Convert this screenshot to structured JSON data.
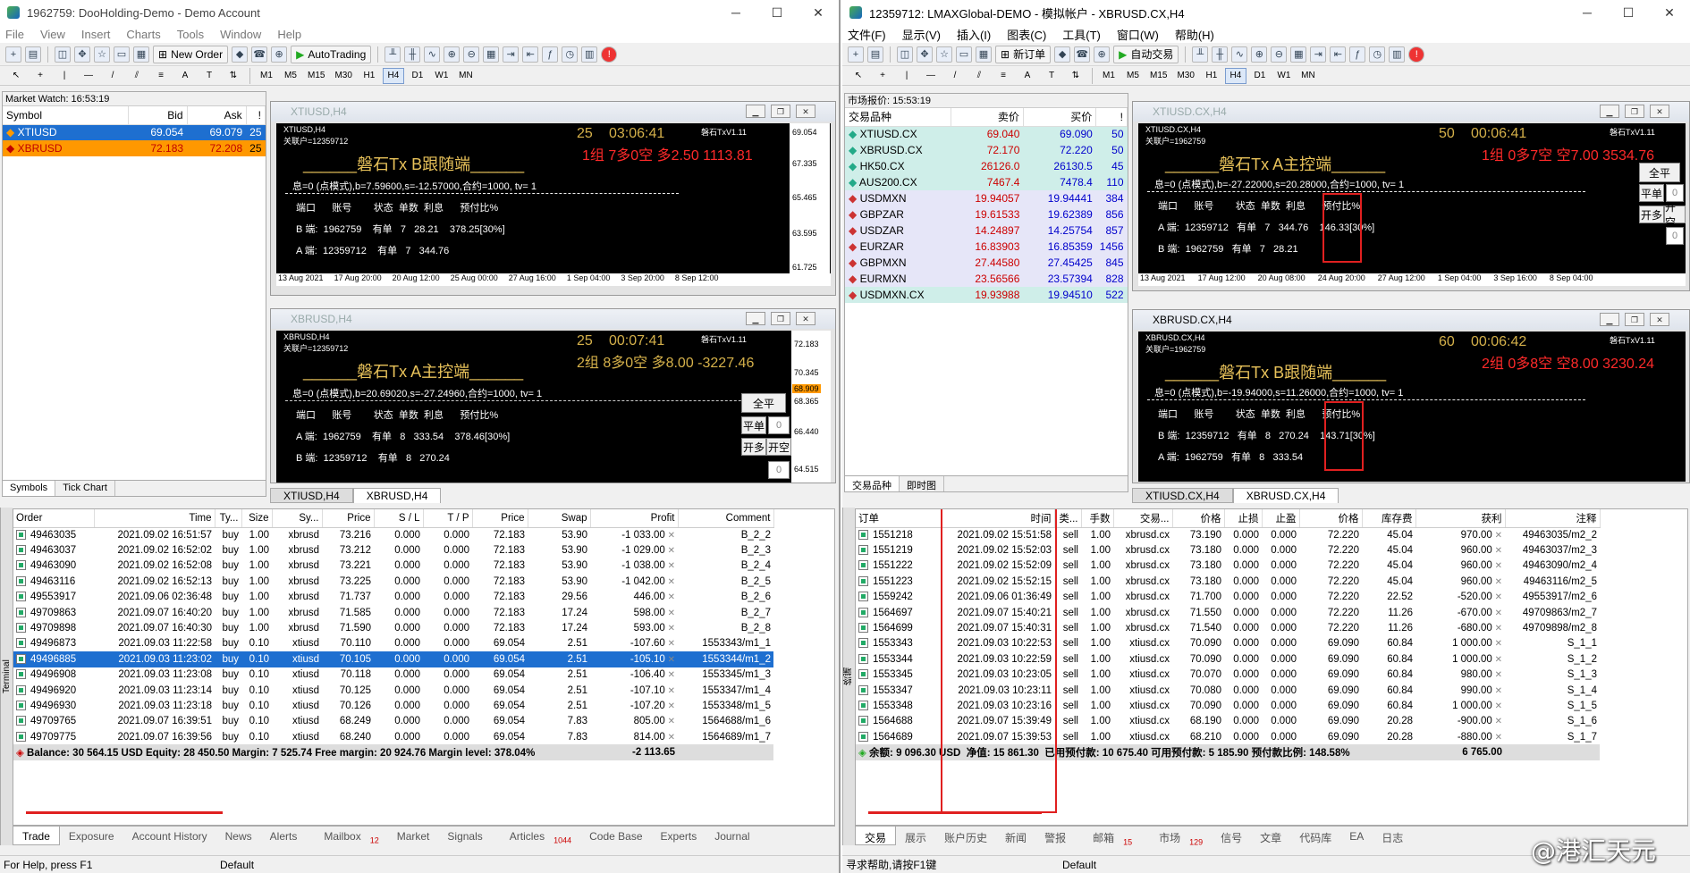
{
  "left": {
    "title": "1962759: DooHolding-Demo - Demo Account",
    "menu": [
      "File",
      "View",
      "Insert",
      "Charts",
      "Tools",
      "Window",
      "Help"
    ],
    "new_order": "New Order",
    "autotrading": "AutoTrading",
    "timeframes": [
      "M1",
      "M5",
      "M15",
      "M30",
      "H1",
      "H4",
      "D1",
      "W1",
      "MN"
    ],
    "market_watch": {
      "title": "Market Watch: 16:53:19",
      "headers": [
        "Symbol",
        "Bid",
        "Ask",
        "!"
      ],
      "rows": [
        [
          "XTIUSD",
          "69.054",
          "69.079",
          "25"
        ],
        [
          "XBRUSD",
          "72.183",
          "72.208",
          "25"
        ]
      ],
      "tabs": [
        "Symbols",
        "Tick Chart"
      ]
    },
    "chart1": {
      "title": "XTIUSD,H4",
      "sym": "XTIUSD,H4",
      "acct": "关联户=12359712",
      "ea": "磐石TxV1.11",
      "count": "25",
      "timer": "03:06:41",
      "status": "1组 7多0空 多2.50 1113.81",
      "heading": "磐石Tx B跟随端",
      "params": "息=0 (点模式),b=7.59600,s=-12.57000,合约=1000, tv= 1",
      "headers": [
        "端口",
        "账号",
        "状态",
        "单数",
        "利息",
        "预付比%"
      ],
      "b_row": [
        "B 端:",
        "1962759",
        "有单",
        "7",
        "28.21",
        "378.25[30%]"
      ],
      "a_row": [
        "A 端:",
        "12359712",
        "有单",
        "7",
        "344.76"
      ],
      "yaxis": [
        "69.054",
        "67.335",
        "65.465",
        "63.595",
        "61.725"
      ],
      "xaxis": [
        "13 Aug 2021",
        "17 Aug 20:00",
        "20 Aug 12:00",
        "25 Aug 00:00",
        "27 Aug 16:00",
        "1 Sep 04:00",
        "3 Sep 20:00",
        "8 Sep 12:00"
      ]
    },
    "chart2": {
      "title": "XBRUSD,H4",
      "sym": "XBRUSD,H4",
      "acct": "关联户=12359712",
      "ea": "磐石TxV1.11",
      "count": "25",
      "timer": "00:07:41",
      "status": "2组 8多0空 多8.00 -3227.46",
      "heading": "磐石Tx A主控端",
      "params": "息=0 (点模式),b=20.69020,s=-27.24960,合约=1000, tv= 1",
      "headers": [
        "端口",
        "账号",
        "状态",
        "单数",
        "利息",
        "预付比%"
      ],
      "a_row": [
        "A 端:",
        "1962759",
        "有单",
        "8",
        "333.54",
        "378.46[30%]"
      ],
      "b_row": [
        "B 端:",
        "12359712",
        "有单",
        "8",
        "270.24"
      ],
      "yaxis": [
        "72.183",
        "70.345",
        "68.909",
        "68.365",
        "66.440",
        "64.515"
      ],
      "btn_close_all": "全平",
      "btn_close": "平单",
      "btn_open_long": "开多",
      "btn_open_short": "开空",
      "val0": "0"
    },
    "chart_tabs": [
      "XTIUSD,H4",
      "XBRUSD,H4"
    ],
    "terminal": {
      "headers": [
        "Order",
        "Time",
        "Ty...",
        "Size",
        "Sy...",
        "Price",
        "S / L",
        "T / P",
        "Price",
        "Swap",
        "Profit",
        "Comment"
      ],
      "rows": [
        [
          "49463035",
          "2021.09.02 16:51:57",
          "buy",
          "1.00",
          "xbrusd",
          "73.216",
          "0.000",
          "0.000",
          "72.183",
          "53.90",
          "-1 033.00",
          "B_2_2"
        ],
        [
          "49463037",
          "2021.09.02 16:52:02",
          "buy",
          "1.00",
          "xbrusd",
          "73.212",
          "0.000",
          "0.000",
          "72.183",
          "53.90",
          "-1 029.00",
          "B_2_3"
        ],
        [
          "49463090",
          "2021.09.02 16:52:08",
          "buy",
          "1.00",
          "xbrusd",
          "73.221",
          "0.000",
          "0.000",
          "72.183",
          "53.90",
          "-1 038.00",
          "B_2_4"
        ],
        [
          "49463116",
          "2021.09.02 16:52:13",
          "buy",
          "1.00",
          "xbrusd",
          "73.225",
          "0.000",
          "0.000",
          "72.183",
          "53.90",
          "-1 042.00",
          "B_2_5"
        ],
        [
          "49553917",
          "2021.09.06 02:36:48",
          "buy",
          "1.00",
          "xbrusd",
          "71.737",
          "0.000",
          "0.000",
          "72.183",
          "29.56",
          "446.00",
          "B_2_6"
        ],
        [
          "49709863",
          "2021.09.07 16:40:20",
          "buy",
          "1.00",
          "xbrusd",
          "71.585",
          "0.000",
          "0.000",
          "72.183",
          "17.24",
          "598.00",
          "B_2_7"
        ],
        [
          "49709898",
          "2021.09.07 16:40:30",
          "buy",
          "1.00",
          "xbrusd",
          "71.590",
          "0.000",
          "0.000",
          "72.183",
          "17.24",
          "593.00",
          "B_2_8"
        ],
        [
          "49496873",
          "2021.09.03 11:22:58",
          "buy",
          "0.10",
          "xtiusd",
          "70.110",
          "0.000",
          "0.000",
          "69.054",
          "2.51",
          "-107.60",
          "1553343/m1_1"
        ],
        [
          "49496885",
          "2021.09.03 11:23:02",
          "buy",
          "0.10",
          "xtiusd",
          "70.105",
          "0.000",
          "0.000",
          "69.054",
          "2.51",
          "-105.10",
          "1553344/m1_2"
        ],
        [
          "49496908",
          "2021.09.03 11:23:08",
          "buy",
          "0.10",
          "xtiusd",
          "70.118",
          "0.000",
          "0.000",
          "69.054",
          "2.51",
          "-106.40",
          "1553345/m1_3"
        ],
        [
          "49496920",
          "2021.09.03 11:23:14",
          "buy",
          "0.10",
          "xtiusd",
          "70.125",
          "0.000",
          "0.000",
          "69.054",
          "2.51",
          "-107.10",
          "1553347/m1_4"
        ],
        [
          "49496930",
          "2021.09.03 11:23:18",
          "buy",
          "0.10",
          "xtiusd",
          "70.126",
          "0.000",
          "0.000",
          "69.054",
          "2.51",
          "-107.20",
          "1553348/m1_5"
        ],
        [
          "49709765",
          "2021.09.07 16:39:51",
          "buy",
          "0.10",
          "xtiusd",
          "68.249",
          "0.000",
          "0.000",
          "69.054",
          "7.83",
          "805.00",
          "1564688/m1_6"
        ],
        [
          "49709775",
          "2021.09.07 16:39:56",
          "buy",
          "0.10",
          "xtiusd",
          "68.240",
          "0.000",
          "0.000",
          "69.054",
          "7.83",
          "814.00",
          "1564689/m1_7"
        ]
      ],
      "selected": 8,
      "summary": "Balance: 30 564.15 USD  Equity: 28 450.50  Margin: 7 525.74  Free margin: 20 924.76  Margin level: 378.04%",
      "summary_profit": "-2 113.65",
      "tabs": [
        "Trade",
        "Exposure",
        "Account History",
        "News",
        "Alerts",
        "Mailbox",
        "Market",
        "Signals",
        "Articles",
        "Code Base",
        "Experts",
        "Journal"
      ],
      "mailbox_badge": "12",
      "articles_badge": "1044",
      "side": "Terminal"
    },
    "status": {
      "help": "For Help, press F1",
      "profile": "Default"
    }
  },
  "right": {
    "title": "12359712: LMAXGlobal-DEMO - 模拟帐户 - XBRUSD.CX,H4",
    "menu": [
      "文件(F)",
      "显示(V)",
      "插入(I)",
      "图表(C)",
      "工具(T)",
      "窗口(W)",
      "帮助(H)"
    ],
    "new_order": "新订单",
    "autotrading": "自动交易",
    "timeframes": [
      "M1",
      "M5",
      "M15",
      "M30",
      "H1",
      "H4",
      "D1",
      "W1",
      "MN"
    ],
    "market_watch": {
      "title": "市场报价: 15:53:19",
      "headers": [
        "交易品种",
        "卖价",
        "买价",
        "!"
      ],
      "rows": [
        [
          "XTIUSD.CX",
          "69.040",
          "69.090",
          "50"
        ],
        [
          "XBRUSD.CX",
          "72.170",
          "72.220",
          "50"
        ],
        [
          "HK50.CX",
          "26126.0",
          "26130.5",
          "45"
        ],
        [
          "AUS200.CX",
          "7467.4",
          "7478.4",
          "110"
        ],
        [
          "USDMXN",
          "19.94057",
          "19.94441",
          "384"
        ],
        [
          "GBPZAR",
          "19.61533",
          "19.62389",
          "856"
        ],
        [
          "USDZAR",
          "14.24897",
          "14.25754",
          "857"
        ],
        [
          "EURZAR",
          "16.83903",
          "16.85359",
          "1456"
        ],
        [
          "GBPMXN",
          "27.44580",
          "27.45425",
          "845"
        ],
        [
          "EURMXN",
          "23.56566",
          "23.57394",
          "828"
        ],
        [
          "USDMXN.CX",
          "19.93988",
          "19.94510",
          "522"
        ]
      ],
      "tabs": [
        "交易品种",
        "即时图"
      ]
    },
    "chart1": {
      "title": "XTIUSD.CX,H4",
      "sym": "XTIUSD.CX,H4",
      "acct": "关联户=1962759",
      "ea": "磐石TxV1.11",
      "count": "50",
      "timer": "00:06:41",
      "status": "1组 0多7空 空7.00 3534.76",
      "heading": "磐石Tx A主控端",
      "params": "息=0 (点模式),b=-27.22000,s=20.28000,合约=1000, tv= 1",
      "headers": [
        "端口",
        "账号",
        "状态",
        "单数",
        "利息",
        "预付比%"
      ],
      "a_row": [
        "A 端:",
        "12359712",
        "有单",
        "7",
        "344.76",
        "146.33[30%]"
      ],
      "b_row": [
        "B 端:",
        "1962759",
        "有单",
        "7",
        "28.21"
      ],
      "xaxis": [
        "13 Aug 2021",
        "17 Aug 12:00",
        "20 Aug 08:00",
        "24 Aug 20:00",
        "27 Aug 12:00",
        "1 Sep 04:00",
        "3 Sep 16:00",
        "8 Sep 04:00"
      ],
      "btn_close_all": "全平",
      "btn_close": "平单",
      "btn_open_long": "开多",
      "btn_open_short": "开空",
      "val0": "0"
    },
    "chart2": {
      "title": "XBRUSD.CX,H4",
      "sym": "XBRUSD.CX,H4",
      "acct": "关联户=1962759",
      "ea": "磐石TxV1.11",
      "count": "60",
      "timer": "00:06:42",
      "status": "2组 0多8空 空8.00 3230.24",
      "heading": "磐石Tx B跟随端",
      "params": "息=0 (点模式),b=-19.94000,s=11.26000,合约=1000, tv= 1",
      "headers": [
        "端口",
        "账号",
        "状态",
        "单数",
        "利息",
        "预付比%"
      ],
      "b_row": [
        "B 端:",
        "12359712",
        "有单",
        "8",
        "270.24",
        "143.71[30%]"
      ],
      "a_row": [
        "A 端:",
        "1962759",
        "有单",
        "8",
        "333.54"
      ]
    },
    "chart_tabs": [
      "XTIUSD.CX,H4",
      "XBRUSD.CX,H4"
    ],
    "terminal": {
      "headers": [
        "订单",
        "时间",
        "类...",
        "手数",
        "交易...",
        "价格",
        "止损",
        "止盈",
        "价格",
        "库存费",
        "获利",
        "注释"
      ],
      "rows": [
        [
          "1551218",
          "2021.09.02 15:51:58",
          "sell",
          "1.00",
          "xbrusd.cx",
          "73.190",
          "0.000",
          "0.000",
          "72.220",
          "45.04",
          "970.00",
          "49463035/m2_2"
        ],
        [
          "1551219",
          "2021.09.02 15:52:03",
          "sell",
          "1.00",
          "xbrusd.cx",
          "73.180",
          "0.000",
          "0.000",
          "72.220",
          "45.04",
          "960.00",
          "49463037/m2_3"
        ],
        [
          "1551222",
          "2021.09.02 15:52:09",
          "sell",
          "1.00",
          "xbrusd.cx",
          "73.180",
          "0.000",
          "0.000",
          "72.220",
          "45.04",
          "960.00",
          "49463090/m2_4"
        ],
        [
          "1551223",
          "2021.09.02 15:52:15",
          "sell",
          "1.00",
          "xbrusd.cx",
          "73.180",
          "0.000",
          "0.000",
          "72.220",
          "45.04",
          "960.00",
          "49463116/m2_5"
        ],
        [
          "1559242",
          "2021.09.06 01:36:49",
          "sell",
          "1.00",
          "xbrusd.cx",
          "71.700",
          "0.000",
          "0.000",
          "72.220",
          "22.52",
          "-520.00",
          "49553917/m2_6"
        ],
        [
          "1564697",
          "2021.09.07 15:40:21",
          "sell",
          "1.00",
          "xbrusd.cx",
          "71.550",
          "0.000",
          "0.000",
          "72.220",
          "11.26",
          "-670.00",
          "49709863/m2_7"
        ],
        [
          "1564699",
          "2021.09.07 15:40:31",
          "sell",
          "1.00",
          "xbrusd.cx",
          "71.540",
          "0.000",
          "0.000",
          "72.220",
          "11.26",
          "-680.00",
          "49709898/m2_8"
        ],
        [
          "1553343",
          "2021.09.03 10:22:53",
          "sell",
          "1.00",
          "xtiusd.cx",
          "70.090",
          "0.000",
          "0.000",
          "69.090",
          "60.84",
          "1 000.00",
          "S_1_1"
        ],
        [
          "1553344",
          "2021.09.03 10:22:59",
          "sell",
          "1.00",
          "xtiusd.cx",
          "70.090",
          "0.000",
          "0.000",
          "69.090",
          "60.84",
          "1 000.00",
          "S_1_2"
        ],
        [
          "1553345",
          "2021.09.03 10:23:05",
          "sell",
          "1.00",
          "xtiusd.cx",
          "70.070",
          "0.000",
          "0.000",
          "69.090",
          "60.84",
          "980.00",
          "S_1_3"
        ],
        [
          "1553347",
          "2021.09.03 10:23:11",
          "sell",
          "1.00",
          "xtiusd.cx",
          "70.080",
          "0.000",
          "0.000",
          "69.090",
          "60.84",
          "990.00",
          "S_1_4"
        ],
        [
          "1553348",
          "2021.09.03 10:23:16",
          "sell",
          "1.00",
          "xtiusd.cx",
          "70.090",
          "0.000",
          "0.000",
          "69.090",
          "60.84",
          "1 000.00",
          "S_1_5"
        ],
        [
          "1564688",
          "2021.09.07 15:39:49",
          "sell",
          "1.00",
          "xtiusd.cx",
          "68.190",
          "0.000",
          "0.000",
          "69.090",
          "20.28",
          "-900.00",
          "S_1_6"
        ],
        [
          "1564689",
          "2021.09.07 15:39:53",
          "sell",
          "1.00",
          "xtiusd.cx",
          "68.210",
          "0.000",
          "0.000",
          "69.090",
          "20.28",
          "-880.00",
          "S_1_7"
        ]
      ],
      "summary_balance": "余额: 9 096.30 USD",
      "summary_equity": "净值: 15 861.30",
      "summary_rest": "已用预付款: 10 675.40  可用预付款: 5 185.90  预付款比例: 148.58%",
      "summary_profit": "6 765.00",
      "tabs": [
        "交易",
        "展示",
        "账户历史",
        "新闻",
        "警报",
        "邮箱",
        "市场",
        "信号",
        "文章",
        "代码库",
        "EA",
        "日志"
      ],
      "mailbox_badge": "15",
      "market_badge": "129",
      "side": "终端"
    },
    "status": {
      "help": "寻求帮助,请按F1键",
      "profile": "Default"
    }
  },
  "watermark": "@港汇天元",
  "colors": {
    "sel": "#1e6fd0",
    "xbr_row": "#ff9800",
    "chart_bg": "#000000",
    "gold": "#d4b04a",
    "red": "#ff2a2a",
    "redbox": "#e02020"
  }
}
